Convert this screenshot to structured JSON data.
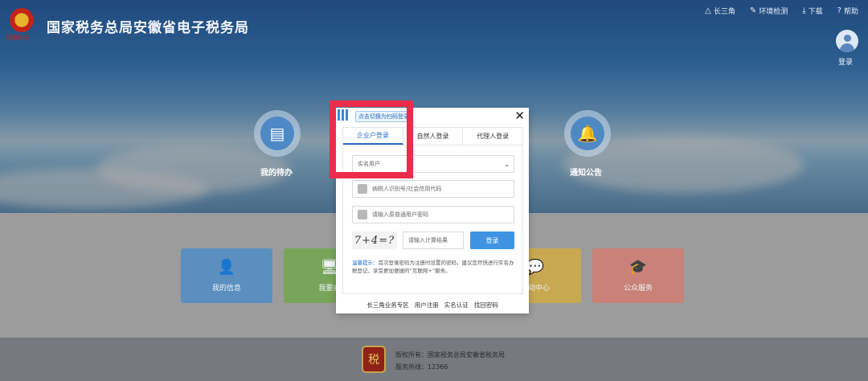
{
  "header": {
    "site_title": "国家税务总局安徽省电子税务局",
    "logo_sub": "税徽标志",
    "nav": [
      {
        "icon": "triangle-icon",
        "glyph": "⚠",
        "label": "长三角"
      },
      {
        "icon": "wrench-icon",
        "glyph": "✎",
        "label": "环境检测"
      },
      {
        "icon": "download-icon",
        "glyph": "⤓",
        "label": "下载"
      },
      {
        "icon": "help-icon",
        "glyph": "?",
        "label": "帮助"
      }
    ],
    "login_label": "登录"
  },
  "hero": {
    "todo_label": "我的待办",
    "notice_label": "通知公告"
  },
  "tiles": [
    {
      "label": "我的信息",
      "color": "#4a8cc7"
    },
    {
      "label": "我要办",
      "color": "#6fb04a"
    },
    {
      "label": "互动中心",
      "color": "#e0b03a"
    },
    {
      "label": "公众服务",
      "color": "#d9766a"
    }
  ],
  "modal": {
    "qr_tip": "点击切换为扫码登录",
    "tabs": [
      "企业户登录",
      "自然人登录",
      "代理人登录"
    ],
    "active_tab": 0,
    "user_type_select": "实名用户",
    "taxpayer_id_placeholder": "纳税人识别号/社会信用代码",
    "password_placeholder": "请输入原普通用户密码",
    "captcha_text": "7+4=?",
    "calc_placeholder": "请输入计算结果",
    "login_button": "登录",
    "tip_label": "温馨提示：",
    "tip_body": "首次登录密码为注册时设置的密码，建议您尽快进行实名办税登记，享受更加便捷的“互联网+”服务。",
    "bottom_links": [
      "长三角业务专区",
      "用户注册",
      "实名认证",
      "找回密码"
    ]
  },
  "footer": {
    "copyright": "版权所有：国家税务总局安徽省税务局",
    "hotline": "服务热线：12366",
    "logo_text": "税"
  },
  "colors": {
    "accent": "#2a6fc0",
    "login_button": "#3f94e2",
    "highlight_box": "#ec2c4b"
  }
}
